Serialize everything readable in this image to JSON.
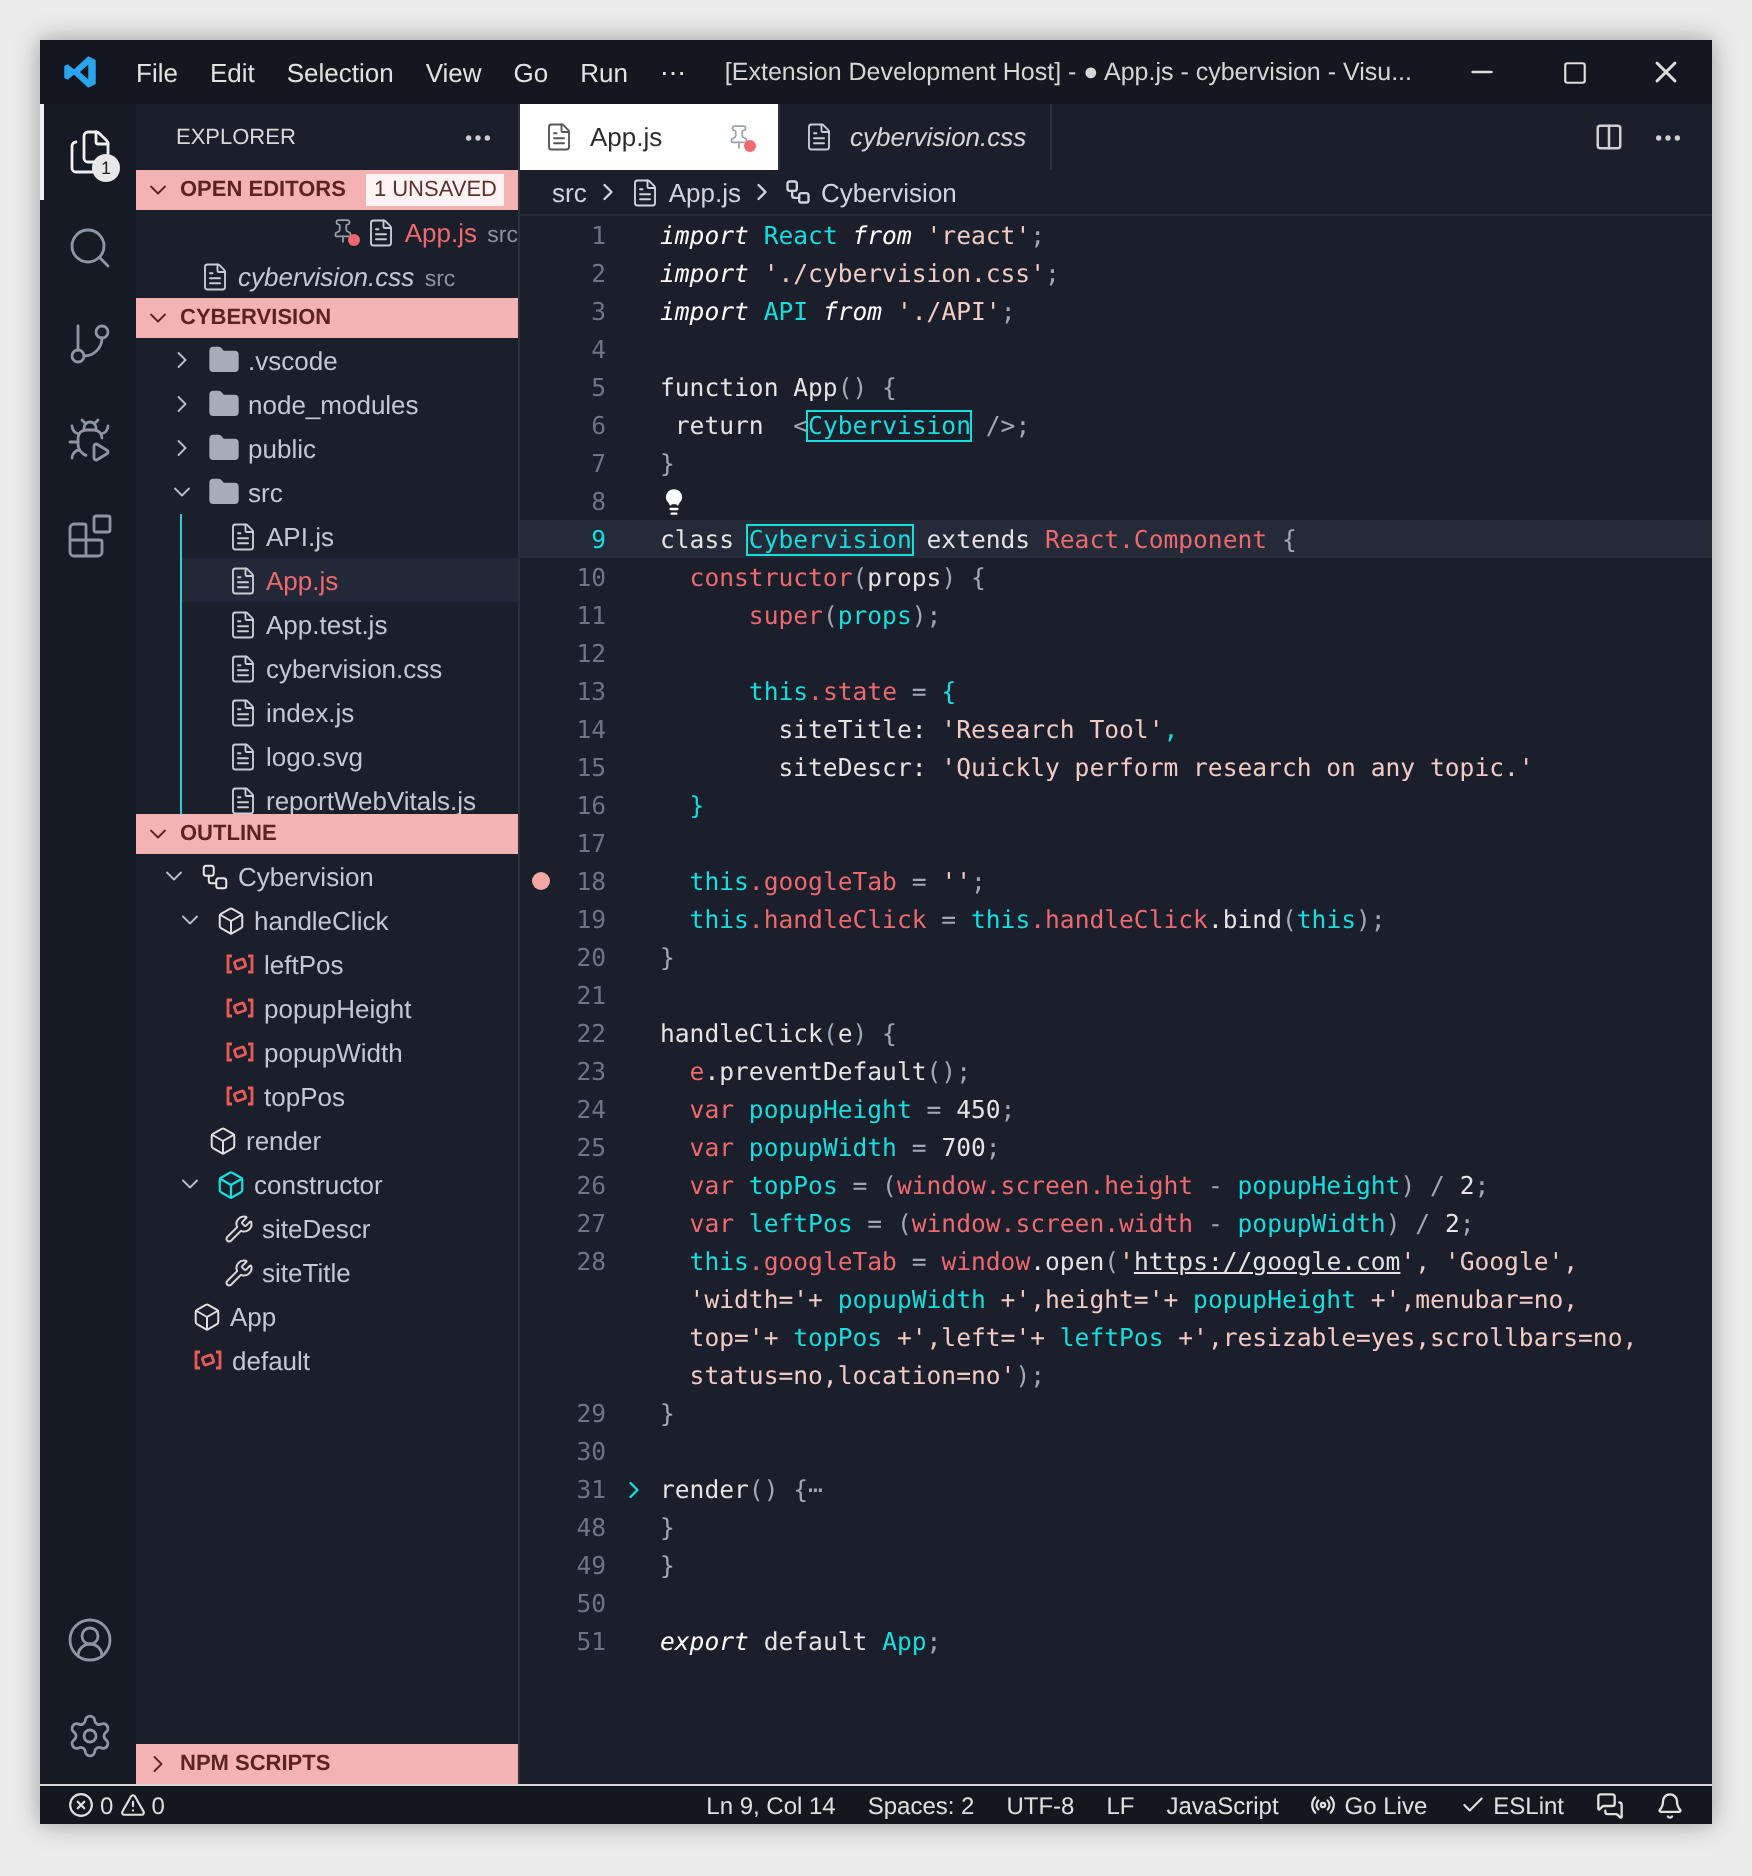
{
  "window": {
    "title": "[Extension Development Host] - ● App.js - cybervision - Visu..."
  },
  "menu": [
    "File",
    "Edit",
    "Selection",
    "View",
    "Go",
    "Run",
    "⋯"
  ],
  "activity_bar": {
    "items": [
      {
        "kind": "explorer",
        "selected": true,
        "badge": "1"
      },
      {
        "kind": "search",
        "selected": false
      },
      {
        "kind": "source_control",
        "selected": false
      },
      {
        "kind": "run",
        "selected": false
      },
      {
        "kind": "extensions",
        "selected": false
      }
    ],
    "bottom": [
      {
        "kind": "account"
      },
      {
        "kind": "settings"
      }
    ]
  },
  "sidebar": {
    "title": "EXPLORER",
    "sections": [
      {
        "kind": "open_editors",
        "title": "OPEN EDITORS",
        "expanded": true,
        "badge": "1 UNSAVED",
        "items": [
          {
            "name": "App.js",
            "folder": "src",
            "modified": true,
            "preview": false,
            "pinned": true
          },
          {
            "name": "cybervision.css",
            "folder": "src",
            "modified": false,
            "preview": true,
            "pinned": false
          }
        ]
      },
      {
        "kind": "folder",
        "title": "CYBERVISION",
        "expanded": true,
        "tree": [
          {
            "name": ".vscode",
            "kind": "folder",
            "expanded": false
          },
          {
            "name": "node_modules",
            "kind": "folder",
            "expanded": false
          },
          {
            "name": "public",
            "kind": "folder",
            "expanded": false
          },
          {
            "name": "src",
            "kind": "folder",
            "expanded": true,
            "children": [
              {
                "name": "API.js",
                "kind": "file",
                "modified": false,
                "selected": false
              },
              {
                "name": "App.js",
                "kind": "file",
                "modified": true,
                "selected": true
              },
              {
                "name": "App.test.js",
                "kind": "file",
                "modified": false,
                "selected": false
              },
              {
                "name": "cybervision.css",
                "kind": "file",
                "modified": false,
                "selected": false
              },
              {
                "name": "index.js",
                "kind": "file",
                "modified": false,
                "selected": false
              },
              {
                "name": "logo.svg",
                "kind": "file",
                "modified": false,
                "selected": false
              },
              {
                "name": "reportWebVitals.js",
                "kind": "file",
                "modified": false,
                "selected": false
              }
            ]
          }
        ]
      },
      {
        "kind": "outline",
        "title": "OUTLINE",
        "expanded": true,
        "tree": [
          {
            "name": "Cybervision",
            "kind": "class",
            "expanded": true,
            "children": [
              {
                "name": "handleClick",
                "kind": "method",
                "expanded": true,
                "children": [
                  {
                    "name": "leftPos",
                    "kind": "variable"
                  },
                  {
                    "name": "popupHeight",
                    "kind": "variable"
                  },
                  {
                    "name": "popupWidth",
                    "kind": "variable"
                  },
                  {
                    "name": "topPos",
                    "kind": "variable"
                  }
                ]
              },
              {
                "name": "render",
                "kind": "method"
              },
              {
                "name": "constructor",
                "kind": "constructor",
                "expanded": true,
                "children": [
                  {
                    "name": "siteDescr",
                    "kind": "property"
                  },
                  {
                    "name": "siteTitle",
                    "kind": "property"
                  }
                ]
              }
            ]
          },
          {
            "name": "App",
            "kind": "method"
          },
          {
            "name": "default",
            "kind": "variable"
          }
        ]
      },
      {
        "kind": "npm",
        "title": "NPM SCRIPTS",
        "expanded": false
      }
    ]
  },
  "tabs": [
    {
      "label": "App.js",
      "selected": true,
      "preview": false,
      "pinned": true,
      "modified": true
    },
    {
      "label": "cybervision.css",
      "selected": false,
      "preview": true,
      "pinned": false,
      "modified": false
    }
  ],
  "breadcrumb": [
    {
      "label": "src",
      "kind": "folder"
    },
    {
      "label": "App.js",
      "kind": "file"
    },
    {
      "label": "Cybervision",
      "kind": "class"
    }
  ],
  "editor": {
    "lines": [
      {
        "number": "1",
        "current": false,
        "tokens": [
          {
            "kind": "keyword",
            "text": "import "
          },
          {
            "kind": "identifier",
            "text": "React "
          },
          {
            "kind": "keyword",
            "text": "from "
          },
          {
            "kind": "string",
            "text": "'react'"
          },
          {
            "kind": "punct",
            "text": ";"
          }
        ]
      },
      {
        "number": "2",
        "current": false,
        "tokens": [
          {
            "kind": "keyword",
            "text": "import "
          },
          {
            "kind": "string",
            "text": "'./cybervision.css'"
          },
          {
            "kind": "punct",
            "text": ";"
          }
        ]
      },
      {
        "number": "3",
        "current": false,
        "tokens": [
          {
            "kind": "keyword",
            "text": "import "
          },
          {
            "kind": "identifier",
            "text": "API "
          },
          {
            "kind": "keyword",
            "text": "from "
          },
          {
            "kind": "string",
            "text": "'./API'"
          },
          {
            "kind": "punct",
            "text": ";"
          }
        ]
      },
      {
        "number": "4",
        "current": false,
        "kind": "plain"
      },
      {
        "number": "5",
        "current": false,
        "tokens": [
          {
            "kind": "plain",
            "text": "function App"
          },
          {
            "kind": "punct",
            "text": "() {"
          }
        ]
      },
      {
        "number": "6",
        "current": false,
        "tokens": [
          {
            "kind": "plain",
            "text": " return  "
          },
          {
            "kind": "punct",
            "text": "<"
          },
          {
            "kind": "match",
            "text": "Cybervision"
          },
          {
            "kind": "punct",
            "text": " />;"
          }
        ]
      },
      {
        "number": "7",
        "current": false,
        "tokens": [
          {
            "kind": "punct",
            "text": "}"
          }
        ]
      },
      {
        "number": "8",
        "current": false,
        "kind": "lightbulb"
      },
      {
        "number": "9",
        "current": true,
        "tokens": [
          {
            "kind": "plain",
            "text": "class "
          },
          {
            "kind": "match",
            "text": "Cybervision"
          },
          {
            "kind": "plain",
            "text": " extends "
          },
          {
            "kind": "member",
            "text": "React.Component"
          },
          {
            "kind": "punct",
            "text": " {"
          }
        ]
      },
      {
        "number": "10",
        "current": false,
        "tokens": [
          {
            "kind": "member",
            "text": "  constructor"
          },
          {
            "kind": "punct",
            "text": "("
          },
          {
            "kind": "plain",
            "text": "props"
          },
          {
            "kind": "punct",
            "text": ") {"
          }
        ]
      },
      {
        "number": "11",
        "current": false,
        "tokens": [
          {
            "kind": "member",
            "text": "      super"
          },
          {
            "kind": "punct",
            "text": "("
          },
          {
            "kind": "identifier",
            "text": "props"
          },
          {
            "kind": "punct",
            "text": ");"
          }
        ]
      },
      {
        "number": "12",
        "current": false,
        "kind": "plain"
      },
      {
        "number": "13",
        "current": false,
        "tokens": [
          {
            "kind": "identifier",
            "text": "      this"
          },
          {
            "kind": "member",
            "text": ".state"
          },
          {
            "kind": "punct",
            "text": " = "
          },
          {
            "kind": "identifier",
            "text": "{"
          }
        ]
      },
      {
        "number": "14",
        "current": false,
        "tokens": [
          {
            "kind": "plain",
            "text": "        siteTitle: "
          },
          {
            "kind": "string",
            "text": "'Research Tool'"
          },
          {
            "kind": "identifier",
            "text": ","
          }
        ]
      },
      {
        "number": "15",
        "current": false,
        "tokens": [
          {
            "kind": "plain",
            "text": "        siteDescr: "
          },
          {
            "kind": "string",
            "text": "'Quickly perform research on any topic.'"
          }
        ]
      },
      {
        "number": "16",
        "current": false,
        "tokens": [
          {
            "kind": "identifier",
            "text": "  }"
          }
        ]
      },
      {
        "number": "17",
        "current": false,
        "kind": "plain"
      },
      {
        "number": "18",
        "current": false,
        "kind": "breakpoint",
        "tokens": [
          {
            "kind": "identifier",
            "text": "  this"
          },
          {
            "kind": "member",
            "text": ".googleTab"
          },
          {
            "kind": "punct",
            "text": " = "
          },
          {
            "kind": "string",
            "text": "''"
          },
          {
            "kind": "punct",
            "text": ";"
          }
        ]
      },
      {
        "number": "19",
        "current": false,
        "tokens": [
          {
            "kind": "identifier",
            "text": "  this"
          },
          {
            "kind": "member",
            "text": ".handleClick"
          },
          {
            "kind": "punct",
            "text": " = "
          },
          {
            "kind": "identifier",
            "text": "this"
          },
          {
            "kind": "member",
            "text": ".handleClick"
          },
          {
            "kind": "plain",
            "text": ".bind"
          },
          {
            "kind": "punct",
            "text": "("
          },
          {
            "kind": "identifier",
            "text": "this"
          },
          {
            "kind": "punct",
            "text": ");"
          }
        ]
      },
      {
        "number": "20",
        "current": false,
        "tokens": [
          {
            "kind": "punct",
            "text": "}"
          }
        ]
      },
      {
        "number": "21",
        "current": false,
        "kind": "plain"
      },
      {
        "number": "22",
        "current": false,
        "tokens": [
          {
            "kind": "plain",
            "text": "handleClick"
          },
          {
            "kind": "punct",
            "text": "("
          },
          {
            "kind": "plain",
            "text": "e"
          },
          {
            "kind": "punct",
            "text": ") {"
          }
        ]
      },
      {
        "number": "23",
        "current": false,
        "tokens": [
          {
            "kind": "member",
            "text": "  e"
          },
          {
            "kind": "plain",
            "text": ".preventDefault"
          },
          {
            "kind": "punct",
            "text": "();"
          }
        ]
      },
      {
        "number": "24",
        "current": false,
        "tokens": [
          {
            "kind": "member",
            "text": "  var "
          },
          {
            "kind": "identifier",
            "text": "popupHeight"
          },
          {
            "kind": "punct",
            "text": " = "
          },
          {
            "kind": "plain",
            "text": "450"
          },
          {
            "kind": "punct",
            "text": ";"
          }
        ]
      },
      {
        "number": "25",
        "current": false,
        "tokens": [
          {
            "kind": "member",
            "text": "  var "
          },
          {
            "kind": "identifier",
            "text": "popupWidth"
          },
          {
            "kind": "punct",
            "text": " = "
          },
          {
            "kind": "plain",
            "text": "700"
          },
          {
            "kind": "punct",
            "text": ";"
          }
        ]
      },
      {
        "number": "26",
        "current": false,
        "tokens": [
          {
            "kind": "member",
            "text": "  var "
          },
          {
            "kind": "identifier",
            "text": "topPos"
          },
          {
            "kind": "punct",
            "text": " = ("
          },
          {
            "kind": "member",
            "text": "window.screen.height"
          },
          {
            "kind": "punct",
            "text": " - "
          },
          {
            "kind": "identifier",
            "text": "popupHeight"
          },
          {
            "kind": "punct",
            "text": ") / "
          },
          {
            "kind": "plain",
            "text": "2"
          },
          {
            "kind": "punct",
            "text": ";"
          }
        ]
      },
      {
        "number": "27",
        "current": false,
        "tokens": [
          {
            "kind": "member",
            "text": "  var "
          },
          {
            "kind": "identifier",
            "text": "leftPos"
          },
          {
            "kind": "punct",
            "text": " = ("
          },
          {
            "kind": "member",
            "text": "window.screen.width"
          },
          {
            "kind": "punct",
            "text": " - "
          },
          {
            "kind": "identifier",
            "text": "popupWidth"
          },
          {
            "kind": "punct",
            "text": ") / "
          },
          {
            "kind": "plain",
            "text": "2"
          },
          {
            "kind": "punct",
            "text": ";"
          }
        ]
      },
      {
        "number": "28",
        "current": false,
        "tokens": [
          {
            "kind": "identifier",
            "text": "  this"
          },
          {
            "kind": "member",
            "text": ".googleTab"
          },
          {
            "kind": "punct",
            "text": " = "
          },
          {
            "kind": "member",
            "text": "window"
          },
          {
            "kind": "plain",
            "text": ".open"
          },
          {
            "kind": "punct",
            "text": "("
          },
          {
            "kind": "string",
            "text": "'"
          },
          {
            "kind": "link",
            "text": "https://google.com"
          },
          {
            "kind": "string",
            "text": "', 'Google',"
          }
        ],
        "wrapped": [
          [
            {
              "kind": "string",
              "text": "  'width='+ "
            },
            {
              "kind": "identifier",
              "text": "popupWidth"
            },
            {
              "kind": "string",
              "text": " +',height='+ "
            },
            {
              "kind": "identifier",
              "text": "popupHeight"
            },
            {
              "kind": "string",
              "text": " +',menubar=no,"
            }
          ],
          [
            {
              "kind": "string",
              "text": "  top='+ "
            },
            {
              "kind": "identifier",
              "text": "topPos"
            },
            {
              "kind": "string",
              "text": " +',left='+ "
            },
            {
              "kind": "identifier",
              "text": "leftPos"
            },
            {
              "kind": "string",
              "text": " +',resizable=yes,scrollbars=no,"
            }
          ],
          [
            {
              "kind": "string",
              "text": "  status=no,location=no'"
            },
            {
              "kind": "punct",
              "text": ");"
            }
          ]
        ]
      },
      {
        "number": "29",
        "current": false,
        "tokens": [
          {
            "kind": "punct",
            "text": "}"
          }
        ]
      },
      {
        "number": "30",
        "current": false,
        "kind": "plain"
      },
      {
        "number": "31",
        "current": false,
        "kind": "fold",
        "tokens": [
          {
            "kind": "plain",
            "text": "render"
          },
          {
            "kind": "punct",
            "text": "() {⋯"
          }
        ]
      },
      {
        "number": "48",
        "current": false,
        "tokens": [
          {
            "kind": "punct",
            "text": "}"
          }
        ]
      },
      {
        "number": "49",
        "current": false,
        "tokens": [
          {
            "kind": "punct",
            "text": "}"
          }
        ]
      },
      {
        "number": "50",
        "current": false,
        "kind": "plain"
      },
      {
        "number": "51",
        "current": false,
        "tokens": [
          {
            "kind": "keyword",
            "text": "export "
          },
          {
            "kind": "plain",
            "text": "default "
          },
          {
            "kind": "identifier",
            "text": "App"
          },
          {
            "kind": "punct",
            "text": ";"
          }
        ]
      }
    ]
  },
  "status_bar": {
    "errors": "0",
    "warnings": "0",
    "items": [
      {
        "kind": "text",
        "label": "Ln 9, Col 14"
      },
      {
        "kind": "text",
        "label": "Spaces: 2"
      },
      {
        "kind": "text",
        "label": "UTF-8"
      },
      {
        "kind": "text",
        "label": "LF"
      },
      {
        "kind": "text",
        "label": "JavaScript"
      },
      {
        "kind": "live",
        "label": "Go Live"
      },
      {
        "kind": "check",
        "label": "ESLint"
      },
      {
        "kind": "feedback"
      },
      {
        "kind": "bell"
      }
    ]
  }
}
